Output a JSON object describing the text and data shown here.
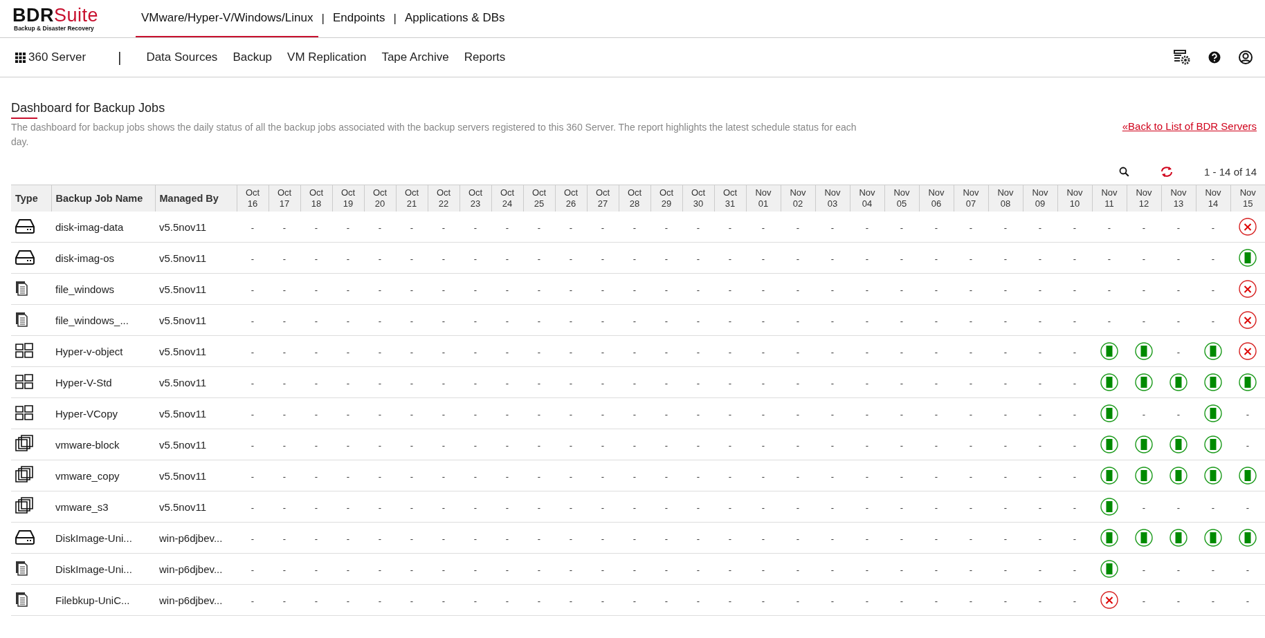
{
  "brand": {
    "name_dark": "BDR",
    "name_accent": "Suite",
    "tagline": "Backup & Disaster Recovery"
  },
  "top_tabs": [
    {
      "label": "VMware/Hyper-V/Windows/Linux",
      "selected": true
    },
    {
      "label": "Endpoints",
      "selected": false
    },
    {
      "label": "Applications & DBs",
      "selected": false
    }
  ],
  "top_separator": "|",
  "nav": {
    "home": "360 Server",
    "separator": "|",
    "items": [
      "Data Sources",
      "Backup",
      "VM Replication",
      "Tape Archive",
      "Reports"
    ]
  },
  "page": {
    "title": "Dashboard for Backup Jobs",
    "description": "The dashboard for backup jobs shows the daily status of all the backup jobs associated with the backup servers registered to this 360 Server. The report highlights the latest schedule status for each day.",
    "back_link": "«Back to List of BDR Servers",
    "pager": "1 - 14 of 14"
  },
  "table": {
    "columns": [
      "Type",
      "Backup Job Name",
      "Managed By"
    ],
    "dates": [
      {
        "month": "Oct",
        "day": "16"
      },
      {
        "month": "Oct",
        "day": "17"
      },
      {
        "month": "Oct",
        "day": "18"
      },
      {
        "month": "Oct",
        "day": "19"
      },
      {
        "month": "Oct",
        "day": "20"
      },
      {
        "month": "Oct",
        "day": "21"
      },
      {
        "month": "Oct",
        "day": "22"
      },
      {
        "month": "Oct",
        "day": "23"
      },
      {
        "month": "Oct",
        "day": "24"
      },
      {
        "month": "Oct",
        "day": "25"
      },
      {
        "month": "Oct",
        "day": "26"
      },
      {
        "month": "Oct",
        "day": "27"
      },
      {
        "month": "Oct",
        "day": "28"
      },
      {
        "month": "Oct",
        "day": "29"
      },
      {
        "month": "Oct",
        "day": "30"
      },
      {
        "month": "Oct",
        "day": "31"
      },
      {
        "month": "Nov",
        "day": "01"
      },
      {
        "month": "Nov",
        "day": "02"
      },
      {
        "month": "Nov",
        "day": "03"
      },
      {
        "month": "Nov",
        "day": "04"
      },
      {
        "month": "Nov",
        "day": "05"
      },
      {
        "month": "Nov",
        "day": "06"
      },
      {
        "month": "Nov",
        "day": "07"
      },
      {
        "month": "Nov",
        "day": "08"
      },
      {
        "month": "Nov",
        "day": "09"
      },
      {
        "month": "Nov",
        "day": "10"
      },
      {
        "month": "Nov",
        "day": "11"
      },
      {
        "month": "Nov",
        "day": "12"
      },
      {
        "month": "Nov",
        "day": "13"
      },
      {
        "month": "Nov",
        "day": "14"
      },
      {
        "month": "Nov",
        "day": "15"
      }
    ],
    "rows": [
      {
        "kind": "disk",
        "name": "disk-imag-data",
        "managed_by": "v5.5nov11",
        "days": [
          {
            "kind": "empty",
            "text": "-"
          },
          {
            "kind": "empty",
            "text": "-"
          },
          {
            "kind": "empty",
            "text": "-"
          },
          {
            "kind": "empty",
            "text": "-"
          },
          {
            "kind": "empty",
            "text": "-"
          },
          {
            "kind": "empty",
            "text": "-"
          },
          {
            "kind": "empty",
            "text": "-"
          },
          {
            "kind": "empty",
            "text": "-"
          },
          {
            "kind": "empty",
            "text": "-"
          },
          {
            "kind": "empty",
            "text": "-"
          },
          {
            "kind": "empty",
            "text": "-"
          },
          {
            "kind": "empty",
            "text": "-"
          },
          {
            "kind": "empty",
            "text": "-"
          },
          {
            "kind": "empty",
            "text": "-"
          },
          {
            "kind": "empty",
            "text": "-"
          },
          {
            "kind": "empty",
            "text": "-"
          },
          {
            "kind": "empty",
            "text": "-"
          },
          {
            "kind": "empty",
            "text": "-"
          },
          {
            "kind": "empty",
            "text": "-"
          },
          {
            "kind": "empty",
            "text": "-"
          },
          {
            "kind": "empty",
            "text": "-"
          },
          {
            "kind": "empty",
            "text": "-"
          },
          {
            "kind": "empty",
            "text": "-"
          },
          {
            "kind": "empty",
            "text": "-"
          },
          {
            "kind": "empty",
            "text": "-"
          },
          {
            "kind": "empty",
            "text": "-"
          },
          {
            "kind": "empty",
            "text": "-"
          },
          {
            "kind": "empty",
            "text": "-"
          },
          {
            "kind": "empty",
            "text": "-"
          },
          {
            "kind": "empty",
            "text": "-"
          },
          {
            "kind": "failed"
          }
        ]
      },
      {
        "kind": "disk",
        "name": "disk-imag-os",
        "managed_by": "v5.5nov11",
        "days": [
          {
            "kind": "empty",
            "text": "-"
          },
          {
            "kind": "empty",
            "text": "-"
          },
          {
            "kind": "empty",
            "text": "-"
          },
          {
            "kind": "empty",
            "text": "-"
          },
          {
            "kind": "empty",
            "text": "-"
          },
          {
            "kind": "empty",
            "text": "-"
          },
          {
            "kind": "empty",
            "text": "-"
          },
          {
            "kind": "empty",
            "text": "-"
          },
          {
            "kind": "empty",
            "text": "-"
          },
          {
            "kind": "empty",
            "text": "-"
          },
          {
            "kind": "empty",
            "text": "-"
          },
          {
            "kind": "empty",
            "text": "-"
          },
          {
            "kind": "empty",
            "text": "-"
          },
          {
            "kind": "empty",
            "text": "-"
          },
          {
            "kind": "empty",
            "text": "-"
          },
          {
            "kind": "empty",
            "text": "-"
          },
          {
            "kind": "empty",
            "text": "-"
          },
          {
            "kind": "empty",
            "text": "-"
          },
          {
            "kind": "empty",
            "text": "-"
          },
          {
            "kind": "empty",
            "text": "-"
          },
          {
            "kind": "empty",
            "text": "-"
          },
          {
            "kind": "empty",
            "text": "-"
          },
          {
            "kind": "empty",
            "text": "-"
          },
          {
            "kind": "empty",
            "text": "-"
          },
          {
            "kind": "empty",
            "text": "-"
          },
          {
            "kind": "empty",
            "text": "-"
          },
          {
            "kind": "empty",
            "text": "-"
          },
          {
            "kind": "empty",
            "text": "-"
          },
          {
            "kind": "empty",
            "text": "-"
          },
          {
            "kind": "empty",
            "text": "-"
          },
          {
            "kind": "success"
          }
        ]
      },
      {
        "kind": "file",
        "name": "file_windows",
        "managed_by": "v5.5nov11",
        "days": [
          {
            "kind": "empty",
            "text": "-"
          },
          {
            "kind": "empty",
            "text": "-"
          },
          {
            "kind": "empty",
            "text": "-"
          },
          {
            "kind": "empty",
            "text": "-"
          },
          {
            "kind": "empty",
            "text": "-"
          },
          {
            "kind": "empty",
            "text": "-"
          },
          {
            "kind": "empty",
            "text": "-"
          },
          {
            "kind": "empty",
            "text": "-"
          },
          {
            "kind": "empty",
            "text": "-"
          },
          {
            "kind": "empty",
            "text": "-"
          },
          {
            "kind": "empty",
            "text": "-"
          },
          {
            "kind": "empty",
            "text": "-"
          },
          {
            "kind": "empty",
            "text": "-"
          },
          {
            "kind": "empty",
            "text": "-"
          },
          {
            "kind": "empty",
            "text": "-"
          },
          {
            "kind": "empty",
            "text": "-"
          },
          {
            "kind": "empty",
            "text": "-"
          },
          {
            "kind": "empty",
            "text": "-"
          },
          {
            "kind": "empty",
            "text": "-"
          },
          {
            "kind": "empty",
            "text": "-"
          },
          {
            "kind": "empty",
            "text": "-"
          },
          {
            "kind": "empty",
            "text": "-"
          },
          {
            "kind": "empty",
            "text": "-"
          },
          {
            "kind": "empty",
            "text": "-"
          },
          {
            "kind": "empty",
            "text": "-"
          },
          {
            "kind": "empty",
            "text": "-"
          },
          {
            "kind": "empty",
            "text": "-"
          },
          {
            "kind": "empty",
            "text": "-"
          },
          {
            "kind": "empty",
            "text": "-"
          },
          {
            "kind": "empty",
            "text": "-"
          },
          {
            "kind": "failed"
          }
        ]
      },
      {
        "kind": "file",
        "name": "file_windows_...",
        "managed_by": "v5.5nov11",
        "days": [
          {
            "kind": "empty",
            "text": "-"
          },
          {
            "kind": "empty",
            "text": "-"
          },
          {
            "kind": "empty",
            "text": "-"
          },
          {
            "kind": "empty",
            "text": "-"
          },
          {
            "kind": "empty",
            "text": "-"
          },
          {
            "kind": "empty",
            "text": "-"
          },
          {
            "kind": "empty",
            "text": "-"
          },
          {
            "kind": "empty",
            "text": "-"
          },
          {
            "kind": "empty",
            "text": "-"
          },
          {
            "kind": "empty",
            "text": "-"
          },
          {
            "kind": "empty",
            "text": "-"
          },
          {
            "kind": "empty",
            "text": "-"
          },
          {
            "kind": "empty",
            "text": "-"
          },
          {
            "kind": "empty",
            "text": "-"
          },
          {
            "kind": "empty",
            "text": "-"
          },
          {
            "kind": "empty",
            "text": "-"
          },
          {
            "kind": "empty",
            "text": "-"
          },
          {
            "kind": "empty",
            "text": "-"
          },
          {
            "kind": "empty",
            "text": "-"
          },
          {
            "kind": "empty",
            "text": "-"
          },
          {
            "kind": "empty",
            "text": "-"
          },
          {
            "kind": "empty",
            "text": "-"
          },
          {
            "kind": "empty",
            "text": "-"
          },
          {
            "kind": "empty",
            "text": "-"
          },
          {
            "kind": "empty",
            "text": "-"
          },
          {
            "kind": "empty",
            "text": "-"
          },
          {
            "kind": "empty",
            "text": "-"
          },
          {
            "kind": "empty",
            "text": "-"
          },
          {
            "kind": "empty",
            "text": "-"
          },
          {
            "kind": "empty",
            "text": "-"
          },
          {
            "kind": "failed"
          }
        ]
      },
      {
        "kind": "hyperv",
        "name": "Hyper-v-object",
        "managed_by": "v5.5nov11",
        "days": [
          {
            "kind": "empty",
            "text": "-"
          },
          {
            "kind": "empty",
            "text": "-"
          },
          {
            "kind": "empty",
            "text": "-"
          },
          {
            "kind": "empty",
            "text": "-"
          },
          {
            "kind": "empty",
            "text": "-"
          },
          {
            "kind": "empty",
            "text": "-"
          },
          {
            "kind": "empty",
            "text": "-"
          },
          {
            "kind": "empty",
            "text": "-"
          },
          {
            "kind": "empty",
            "text": "-"
          },
          {
            "kind": "empty",
            "text": "-"
          },
          {
            "kind": "empty",
            "text": "-"
          },
          {
            "kind": "empty",
            "text": "-"
          },
          {
            "kind": "empty",
            "text": "-"
          },
          {
            "kind": "empty",
            "text": "-"
          },
          {
            "kind": "empty",
            "text": "-"
          },
          {
            "kind": "empty",
            "text": "-"
          },
          {
            "kind": "empty",
            "text": "-"
          },
          {
            "kind": "empty",
            "text": "-"
          },
          {
            "kind": "empty",
            "text": "-"
          },
          {
            "kind": "empty",
            "text": "-"
          },
          {
            "kind": "empty",
            "text": "-"
          },
          {
            "kind": "empty",
            "text": "-"
          },
          {
            "kind": "empty",
            "text": "-"
          },
          {
            "kind": "empty",
            "text": "-"
          },
          {
            "kind": "empty",
            "text": "-"
          },
          {
            "kind": "empty",
            "text": "-"
          },
          {
            "kind": "success"
          },
          {
            "kind": "success"
          },
          {
            "kind": "empty",
            "text": "-"
          },
          {
            "kind": "success"
          },
          {
            "kind": "failed"
          }
        ]
      },
      {
        "kind": "hyperv",
        "name": "Hyper-V-Std",
        "managed_by": "v5.5nov11",
        "days": [
          {
            "kind": "empty",
            "text": "-"
          },
          {
            "kind": "empty",
            "text": "-"
          },
          {
            "kind": "empty",
            "text": "-"
          },
          {
            "kind": "empty",
            "text": "-"
          },
          {
            "kind": "empty",
            "text": "-"
          },
          {
            "kind": "empty",
            "text": "-"
          },
          {
            "kind": "empty",
            "text": "-"
          },
          {
            "kind": "empty",
            "text": "-"
          },
          {
            "kind": "empty",
            "text": "-"
          },
          {
            "kind": "empty",
            "text": "-"
          },
          {
            "kind": "empty",
            "text": "-"
          },
          {
            "kind": "empty",
            "text": "-"
          },
          {
            "kind": "empty",
            "text": "-"
          },
          {
            "kind": "empty",
            "text": "-"
          },
          {
            "kind": "empty",
            "text": "-"
          },
          {
            "kind": "empty",
            "text": "-"
          },
          {
            "kind": "empty",
            "text": "-"
          },
          {
            "kind": "empty",
            "text": "-"
          },
          {
            "kind": "empty",
            "text": "-"
          },
          {
            "kind": "empty",
            "text": "-"
          },
          {
            "kind": "empty",
            "text": "-"
          },
          {
            "kind": "empty",
            "text": "-"
          },
          {
            "kind": "empty",
            "text": "-"
          },
          {
            "kind": "empty",
            "text": "-"
          },
          {
            "kind": "empty",
            "text": "-"
          },
          {
            "kind": "empty",
            "text": "-"
          },
          {
            "kind": "success"
          },
          {
            "kind": "success"
          },
          {
            "kind": "success"
          },
          {
            "kind": "success"
          },
          {
            "kind": "success"
          }
        ]
      },
      {
        "kind": "hyperv",
        "name": "Hyper-VCopy",
        "managed_by": "v5.5nov11",
        "days": [
          {
            "kind": "empty",
            "text": "-"
          },
          {
            "kind": "empty",
            "text": "-"
          },
          {
            "kind": "empty",
            "text": "-"
          },
          {
            "kind": "empty",
            "text": "-"
          },
          {
            "kind": "empty",
            "text": "-"
          },
          {
            "kind": "empty",
            "text": "-"
          },
          {
            "kind": "empty",
            "text": "-"
          },
          {
            "kind": "empty",
            "text": "-"
          },
          {
            "kind": "empty",
            "text": "-"
          },
          {
            "kind": "empty",
            "text": "-"
          },
          {
            "kind": "empty",
            "text": "-"
          },
          {
            "kind": "empty",
            "text": "-"
          },
          {
            "kind": "empty",
            "text": "-"
          },
          {
            "kind": "empty",
            "text": "-"
          },
          {
            "kind": "empty",
            "text": "-"
          },
          {
            "kind": "empty",
            "text": "-"
          },
          {
            "kind": "empty",
            "text": "-"
          },
          {
            "kind": "empty",
            "text": "-"
          },
          {
            "kind": "empty",
            "text": "-"
          },
          {
            "kind": "empty",
            "text": "-"
          },
          {
            "kind": "empty",
            "text": "-"
          },
          {
            "kind": "empty",
            "text": "-"
          },
          {
            "kind": "empty",
            "text": "-"
          },
          {
            "kind": "empty",
            "text": "-"
          },
          {
            "kind": "empty",
            "text": "-"
          },
          {
            "kind": "empty",
            "text": "-"
          },
          {
            "kind": "success"
          },
          {
            "kind": "empty",
            "text": "-"
          },
          {
            "kind": "empty",
            "text": "-"
          },
          {
            "kind": "success"
          },
          {
            "kind": "empty",
            "text": "-"
          }
        ]
      },
      {
        "kind": "vmware",
        "name": "vmware-block",
        "managed_by": "v5.5nov11",
        "days": [
          {
            "kind": "empty",
            "text": "-"
          },
          {
            "kind": "empty",
            "text": "-"
          },
          {
            "kind": "empty",
            "text": "-"
          },
          {
            "kind": "empty",
            "text": "-"
          },
          {
            "kind": "empty",
            "text": "-"
          },
          {
            "kind": "empty",
            "text": "-"
          },
          {
            "kind": "empty",
            "text": "-"
          },
          {
            "kind": "empty",
            "text": "-"
          },
          {
            "kind": "empty",
            "text": "-"
          },
          {
            "kind": "empty",
            "text": "-"
          },
          {
            "kind": "empty",
            "text": "-"
          },
          {
            "kind": "empty",
            "text": "-"
          },
          {
            "kind": "empty",
            "text": "-"
          },
          {
            "kind": "empty",
            "text": "-"
          },
          {
            "kind": "empty",
            "text": "-"
          },
          {
            "kind": "empty",
            "text": "-"
          },
          {
            "kind": "empty",
            "text": "-"
          },
          {
            "kind": "empty",
            "text": "-"
          },
          {
            "kind": "empty",
            "text": "-"
          },
          {
            "kind": "empty",
            "text": "-"
          },
          {
            "kind": "empty",
            "text": "-"
          },
          {
            "kind": "empty",
            "text": "-"
          },
          {
            "kind": "empty",
            "text": "-"
          },
          {
            "kind": "empty",
            "text": "-"
          },
          {
            "kind": "empty",
            "text": "-"
          },
          {
            "kind": "empty",
            "text": "-"
          },
          {
            "kind": "success"
          },
          {
            "kind": "success"
          },
          {
            "kind": "success"
          },
          {
            "kind": "success"
          },
          {
            "kind": "empty",
            "text": "-"
          }
        ]
      },
      {
        "kind": "vmware",
        "name": "vmware_copy",
        "managed_by": "v5.5nov11",
        "days": [
          {
            "kind": "empty",
            "text": "-"
          },
          {
            "kind": "empty",
            "text": "-"
          },
          {
            "kind": "empty",
            "text": "-"
          },
          {
            "kind": "empty",
            "text": "-"
          },
          {
            "kind": "empty",
            "text": "-"
          },
          {
            "kind": "empty",
            "text": "-"
          },
          {
            "kind": "empty",
            "text": "-"
          },
          {
            "kind": "empty",
            "text": "-"
          },
          {
            "kind": "empty",
            "text": "-"
          },
          {
            "kind": "empty",
            "text": "-"
          },
          {
            "kind": "empty",
            "text": "-"
          },
          {
            "kind": "empty",
            "text": "-"
          },
          {
            "kind": "empty",
            "text": "-"
          },
          {
            "kind": "empty",
            "text": "-"
          },
          {
            "kind": "empty",
            "text": "-"
          },
          {
            "kind": "empty",
            "text": "-"
          },
          {
            "kind": "empty",
            "text": "-"
          },
          {
            "kind": "empty",
            "text": "-"
          },
          {
            "kind": "empty",
            "text": "-"
          },
          {
            "kind": "empty",
            "text": "-"
          },
          {
            "kind": "empty",
            "text": "-"
          },
          {
            "kind": "empty",
            "text": "-"
          },
          {
            "kind": "empty",
            "text": "-"
          },
          {
            "kind": "empty",
            "text": "-"
          },
          {
            "kind": "empty",
            "text": "-"
          },
          {
            "kind": "empty",
            "text": "-"
          },
          {
            "kind": "success"
          },
          {
            "kind": "success"
          },
          {
            "kind": "success"
          },
          {
            "kind": "success"
          },
          {
            "kind": "success"
          }
        ]
      },
      {
        "kind": "vmware",
        "name": "vmware_s3",
        "managed_by": "v5.5nov11",
        "days": [
          {
            "kind": "empty",
            "text": "-"
          },
          {
            "kind": "empty",
            "text": "-"
          },
          {
            "kind": "empty",
            "text": "-"
          },
          {
            "kind": "empty",
            "text": "-"
          },
          {
            "kind": "empty",
            "text": "-"
          },
          {
            "kind": "empty",
            "text": "-"
          },
          {
            "kind": "empty",
            "text": "-"
          },
          {
            "kind": "empty",
            "text": "-"
          },
          {
            "kind": "empty",
            "text": "-"
          },
          {
            "kind": "empty",
            "text": "-"
          },
          {
            "kind": "empty",
            "text": "-"
          },
          {
            "kind": "empty",
            "text": "-"
          },
          {
            "kind": "empty",
            "text": "-"
          },
          {
            "kind": "empty",
            "text": "-"
          },
          {
            "kind": "empty",
            "text": "-"
          },
          {
            "kind": "empty",
            "text": "-"
          },
          {
            "kind": "empty",
            "text": "-"
          },
          {
            "kind": "empty",
            "text": "-"
          },
          {
            "kind": "empty",
            "text": "-"
          },
          {
            "kind": "empty",
            "text": "-"
          },
          {
            "kind": "empty",
            "text": "-"
          },
          {
            "kind": "empty",
            "text": "-"
          },
          {
            "kind": "empty",
            "text": "-"
          },
          {
            "kind": "empty",
            "text": "-"
          },
          {
            "kind": "empty",
            "text": "-"
          },
          {
            "kind": "empty",
            "text": "-"
          },
          {
            "kind": "success"
          },
          {
            "kind": "empty",
            "text": "-"
          },
          {
            "kind": "empty",
            "text": "-"
          },
          {
            "kind": "empty",
            "text": "-"
          },
          {
            "kind": "empty",
            "text": "-"
          }
        ]
      },
      {
        "kind": "disk",
        "name": "DiskImage-Uni...",
        "managed_by": "win-p6djbev...",
        "days": [
          {
            "kind": "empty",
            "text": "-"
          },
          {
            "kind": "empty",
            "text": "-"
          },
          {
            "kind": "empty",
            "text": "-"
          },
          {
            "kind": "empty",
            "text": "-"
          },
          {
            "kind": "empty",
            "text": "-"
          },
          {
            "kind": "empty",
            "text": "-"
          },
          {
            "kind": "empty",
            "text": "-"
          },
          {
            "kind": "empty",
            "text": "-"
          },
          {
            "kind": "empty",
            "text": "-"
          },
          {
            "kind": "empty",
            "text": "-"
          },
          {
            "kind": "empty",
            "text": "-"
          },
          {
            "kind": "empty",
            "text": "-"
          },
          {
            "kind": "empty",
            "text": "-"
          },
          {
            "kind": "empty",
            "text": "-"
          },
          {
            "kind": "empty",
            "text": "-"
          },
          {
            "kind": "empty",
            "text": "-"
          },
          {
            "kind": "empty",
            "text": "-"
          },
          {
            "kind": "empty",
            "text": "-"
          },
          {
            "kind": "empty",
            "text": "-"
          },
          {
            "kind": "empty",
            "text": "-"
          },
          {
            "kind": "empty",
            "text": "-"
          },
          {
            "kind": "empty",
            "text": "-"
          },
          {
            "kind": "empty",
            "text": "-"
          },
          {
            "kind": "empty",
            "text": "-"
          },
          {
            "kind": "empty",
            "text": "-"
          },
          {
            "kind": "empty",
            "text": "-"
          },
          {
            "kind": "success"
          },
          {
            "kind": "success"
          },
          {
            "kind": "success"
          },
          {
            "kind": "success"
          },
          {
            "kind": "success"
          }
        ]
      },
      {
        "kind": "file",
        "name": "DiskImage-Uni...",
        "managed_by": "win-p6djbev...",
        "days": [
          {
            "kind": "empty",
            "text": "-"
          },
          {
            "kind": "empty",
            "text": "-"
          },
          {
            "kind": "empty",
            "text": "-"
          },
          {
            "kind": "empty",
            "text": "-"
          },
          {
            "kind": "empty",
            "text": "-"
          },
          {
            "kind": "empty",
            "text": "-"
          },
          {
            "kind": "empty",
            "text": "-"
          },
          {
            "kind": "empty",
            "text": "-"
          },
          {
            "kind": "empty",
            "text": "-"
          },
          {
            "kind": "empty",
            "text": "-"
          },
          {
            "kind": "empty",
            "text": "-"
          },
          {
            "kind": "empty",
            "text": "-"
          },
          {
            "kind": "empty",
            "text": "-"
          },
          {
            "kind": "empty",
            "text": "-"
          },
          {
            "kind": "empty",
            "text": "-"
          },
          {
            "kind": "empty",
            "text": "-"
          },
          {
            "kind": "empty",
            "text": "-"
          },
          {
            "kind": "empty",
            "text": "-"
          },
          {
            "kind": "empty",
            "text": "-"
          },
          {
            "kind": "empty",
            "text": "-"
          },
          {
            "kind": "empty",
            "text": "-"
          },
          {
            "kind": "empty",
            "text": "-"
          },
          {
            "kind": "empty",
            "text": "-"
          },
          {
            "kind": "empty",
            "text": "-"
          },
          {
            "kind": "empty",
            "text": "-"
          },
          {
            "kind": "empty",
            "text": "-"
          },
          {
            "kind": "success"
          },
          {
            "kind": "empty",
            "text": "-"
          },
          {
            "kind": "empty",
            "text": "-"
          },
          {
            "kind": "empty",
            "text": "-"
          },
          {
            "kind": "empty",
            "text": "-"
          }
        ]
      },
      {
        "kind": "file",
        "name": "Filebkup-UniC...",
        "managed_by": "win-p6djbev...",
        "days": [
          {
            "kind": "empty",
            "text": "-"
          },
          {
            "kind": "empty",
            "text": "-"
          },
          {
            "kind": "empty",
            "text": "-"
          },
          {
            "kind": "empty",
            "text": "-"
          },
          {
            "kind": "empty",
            "text": "-"
          },
          {
            "kind": "empty",
            "text": "-"
          },
          {
            "kind": "empty",
            "text": "-"
          },
          {
            "kind": "empty",
            "text": "-"
          },
          {
            "kind": "empty",
            "text": "-"
          },
          {
            "kind": "empty",
            "text": "-"
          },
          {
            "kind": "empty",
            "text": "-"
          },
          {
            "kind": "empty",
            "text": "-"
          },
          {
            "kind": "empty",
            "text": "-"
          },
          {
            "kind": "empty",
            "text": "-"
          },
          {
            "kind": "empty",
            "text": "-"
          },
          {
            "kind": "empty",
            "text": "-"
          },
          {
            "kind": "empty",
            "text": "-"
          },
          {
            "kind": "empty",
            "text": "-"
          },
          {
            "kind": "empty",
            "text": "-"
          },
          {
            "kind": "empty",
            "text": "-"
          },
          {
            "kind": "empty",
            "text": "-"
          },
          {
            "kind": "empty",
            "text": "-"
          },
          {
            "kind": "empty",
            "text": "-"
          },
          {
            "kind": "empty",
            "text": "-"
          },
          {
            "kind": "empty",
            "text": "-"
          },
          {
            "kind": "empty",
            "text": "-"
          },
          {
            "kind": "failed"
          },
          {
            "kind": "empty",
            "text": "-"
          },
          {
            "kind": "empty",
            "text": "-"
          },
          {
            "kind": "empty",
            "text": "-"
          },
          {
            "kind": "empty",
            "text": "-"
          }
        ]
      }
    ]
  }
}
